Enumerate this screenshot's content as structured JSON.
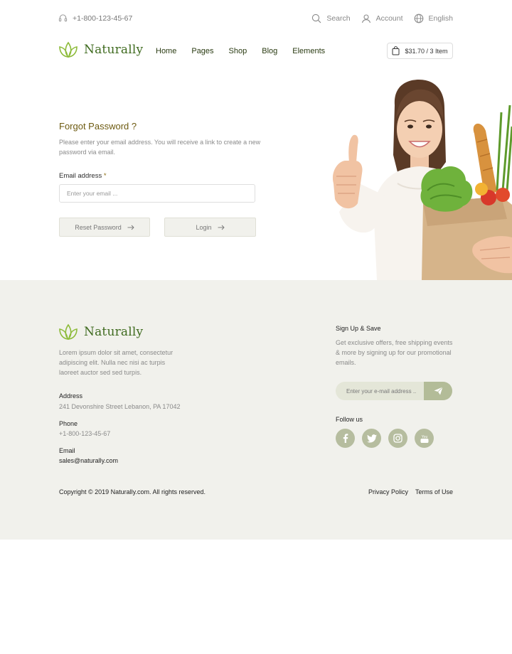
{
  "topbar": {
    "phone": "+1-800-123-45-67",
    "search_label": "Search",
    "account_label": "Account",
    "language_label": "English"
  },
  "brand": {
    "name": "Naturally",
    "color": "#3f6b1f",
    "leaf_color": "#8dbb3a"
  },
  "nav": {
    "items": [
      "Home",
      "Pages",
      "Shop",
      "Blog",
      "Elements"
    ]
  },
  "cart": {
    "summary": "$31.70 / 3 Item"
  },
  "form": {
    "title": "Forgot Password ?",
    "description": "Please enter your email address. You will receive a link to create a new password via email.",
    "email_label": "Email address",
    "required_marker": "*",
    "email_placeholder": "Enter your email ...",
    "reset_button": "Reset Password",
    "login_button": "Login"
  },
  "footer": {
    "description": "Lorem ipsum dolor sit amet, consectetur adipiscing elit. Nulla nec nisi ac turpis laoreet auctor sed sed turpis.",
    "address_label": "Address",
    "address_value": "241 Devonshire Street Lebanon, PA 17042",
    "phone_label": "Phone",
    "phone_value": "+1-800-123-45-67",
    "email_label": "Email",
    "email_value": "sales@naturally.com",
    "signup_title": "Sign Up & Save",
    "signup_description": "Get exclusive offers, free shipping events & more by signing up for our promotional emails.",
    "newsletter_placeholder": "Enter your e-mail address ..",
    "follow_title": "Follow us",
    "socials": [
      "facebook-icon",
      "twitter-icon",
      "instagram-icon",
      "youtube-icon"
    ],
    "youtube_glyph_text": "You",
    "copyright": "Copyright © 2019 Naturally.com. All rights reserved.",
    "privacy_link": "Privacy Policy",
    "terms_link": "Terms of Use",
    "background": "#f1f1ec",
    "accent": "#b6bd9f"
  }
}
